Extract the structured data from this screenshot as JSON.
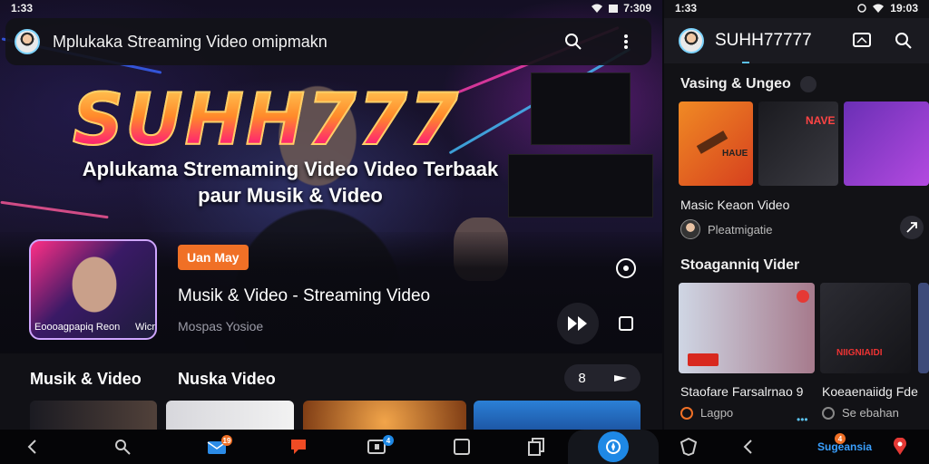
{
  "left": {
    "status": {
      "time": "1:33",
      "battery": "7:309"
    },
    "topbar": {
      "title": "Mplukaka Streaming Video omipmakn"
    },
    "hero": {
      "brand": "SUHH777",
      "tagline_line1": "Aplukama Stremaming Video Video Terbaak",
      "tagline_line2": "paur Musik & Video"
    },
    "player": {
      "thumb_caption_left": "Eoooagpapiq Reon",
      "thumb_caption_right": "Wicr",
      "badge": "Uan May",
      "title": "Musik & Video - Streaming Video",
      "subtitle": "Mospas Yosioe"
    },
    "row": {
      "heading1": "Musik & Video",
      "heading2": "Nuska Video",
      "pill_value": "8"
    }
  },
  "right": {
    "status": {
      "time": "1:33",
      "battery": "19:03"
    },
    "topbar": {
      "title": "SUHH77777"
    },
    "section1": {
      "heading": "Vasing & Ungeo",
      "card_title": "Masic Keaon Video",
      "channel": "Pleatmigatie"
    },
    "section2": {
      "heading": "Stoaganniq Vider",
      "card1_title": "Staofare Farsalrnao 9",
      "card1_meta": "Lagpo",
      "card2_title": "Koeaenaiidg Fde",
      "card2_meta": "Se ebahan",
      "card2_art": "NIIGNIAIDI"
    },
    "tile_texts": {
      "t1": "HAUE",
      "t2": "NAVE",
      "t3": ""
    }
  },
  "nav": {
    "badge1": "19",
    "badge2": "4",
    "badge3": "4",
    "brand_text": "Sugeansia"
  },
  "colors": {
    "accent_orange": "#f07026",
    "accent_blue": "#1e88e5",
    "brand_gradient_top": "#ffd35c",
    "brand_gradient_bottom": "#c7167d"
  }
}
